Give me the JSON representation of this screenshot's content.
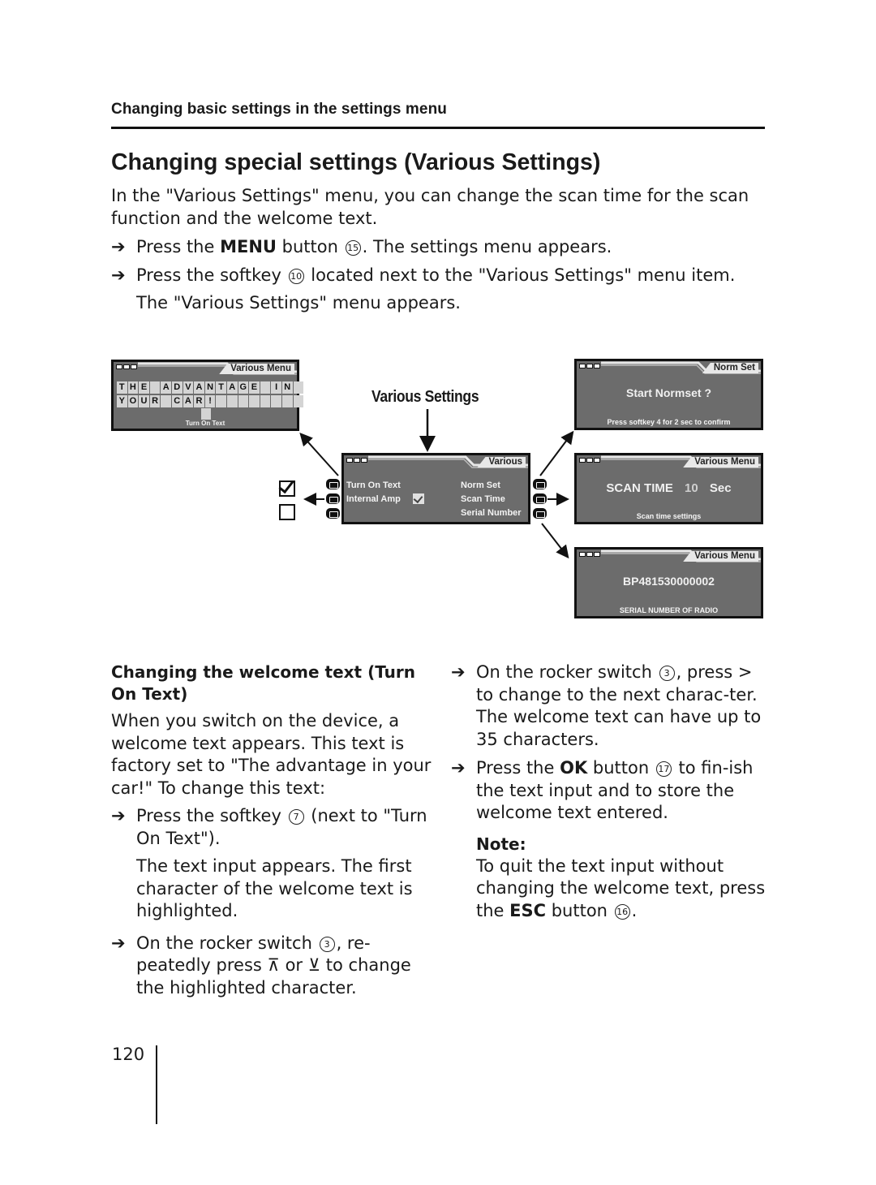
{
  "running_head": "Changing basic settings in the settings menu",
  "title": "Changing special settings (Various Settings)",
  "intro": "In the \"Various Settings\" menu, you can change the scan time for the scan function and the welcome text.",
  "arrow_glyph": "➔",
  "steps_top": [
    {
      "pre": "Press the ",
      "bold": "MENU",
      "mid": " button ",
      "circle": "15",
      "post": ". The settings menu appears."
    },
    {
      "pre": "Press the softkey ",
      "circle": "10",
      "post": " located next to the \"Various Settings\" menu item."
    }
  ],
  "steps_top_result": "The \"Various Settings\" menu appears.",
  "diagram": {
    "label": "Various Settings",
    "screens": {
      "turn_on_text": {
        "tab": "Various Menu",
        "row1": [
          "T",
          "H",
          "E",
          "",
          "A",
          "D",
          "V",
          "A",
          "N",
          "T",
          "A",
          "G",
          "E",
          "",
          "I",
          "N",
          ""
        ],
        "row2": [
          "Y",
          "O",
          "U",
          "R",
          "",
          "C",
          "A",
          "R",
          "!",
          "",
          "",
          "",
          "",
          "",
          "",
          "",
          ""
        ],
        "footer": "Turn On Text"
      },
      "various": {
        "tab": "Various",
        "left_items": [
          "Turn On Text",
          "Internal Amp"
        ],
        "internal_amp_checked": true,
        "right_items": [
          "Norm Set",
          "Scan Time",
          "Serial Number"
        ]
      },
      "norm_set": {
        "tab": "Norm Set",
        "main": "Start Normset ?",
        "footer": "Press softkey 4 for 2 sec to confirm"
      },
      "scan_time": {
        "tab": "Various Menu",
        "label": "SCAN TIME",
        "value": "10",
        "unit": "Sec",
        "footer": "Scan time settings"
      },
      "serial": {
        "tab": "Various Menu",
        "main": "BP481530000002",
        "footer": "SERIAL NUMBER OF RADIO"
      }
    },
    "checkbox_states": {
      "checked": true,
      "unchecked": false
    }
  },
  "section2": {
    "heading": "Changing the welcome text (Turn On Text)",
    "para": "When you switch on the device, a welcome text appears. This text is factory set to \"The advantage in your car!\" To change this text:",
    "step1": {
      "pre": "Press the softkey ",
      "circle": "7",
      "post": " (next to \"Turn On Text\")."
    },
    "step1_result": "The text input appears. The first character of the welcome text is highlighted.",
    "step2": {
      "pre": "On the rocker switch ",
      "circle": "3",
      "post1": ", re-peatedly press ",
      "up": "⊼",
      "or": " or ",
      "down": "⊻",
      "post2": " to change the highlighted character."
    },
    "step3": {
      "pre": "On the rocker switch ",
      "circle": "3",
      "post": ", press > to change to the next charac-ter. The welcome text can have up to 35 characters."
    },
    "step4": {
      "pre": "Press the ",
      "bold": "OK",
      "mid": " button ",
      "circle": "17",
      "post": " to fin-ish the text input and to store the welcome text entered."
    },
    "note_title": "Note:",
    "note": {
      "pre": "To quit the text input without changing the welcome text, press the ",
      "bold": "ESC",
      "mid": " button ",
      "circle": "16",
      "post": "."
    }
  },
  "page_number": "120"
}
